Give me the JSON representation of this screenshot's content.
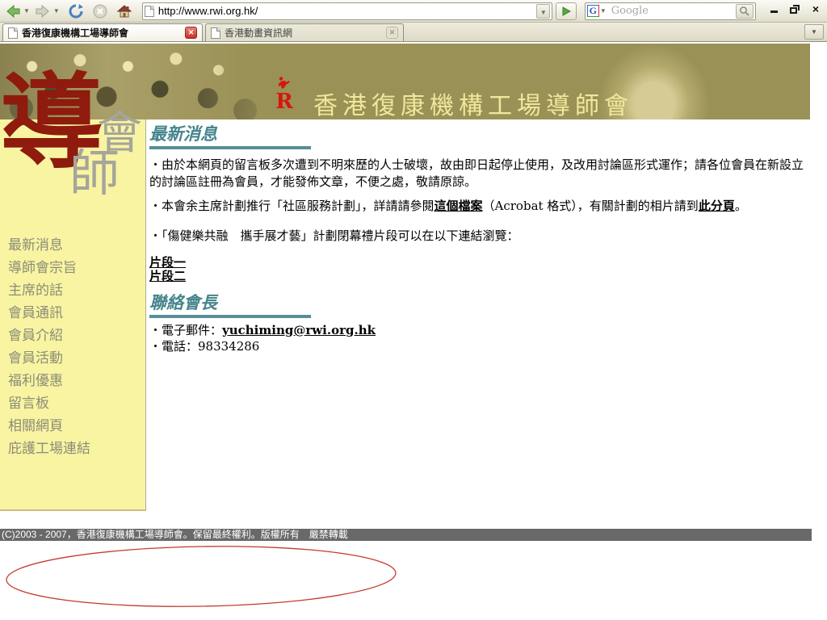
{
  "browser": {
    "url": "http://www.rwi.org.hk/",
    "search": {
      "placeholder": "Google",
      "engine_letter": "G"
    },
    "go_label": "",
    "tabs": [
      {
        "title": "香港復康機構工場導師會"
      },
      {
        "title": "香港動畫資訊網"
      }
    ]
  },
  "banner": {
    "title": "香港復康機構工場導師會",
    "logo_letter": "R"
  },
  "sidebar": {
    "calligraphy": {
      "main": "導",
      "secondary": "會",
      "tertiary": "師"
    },
    "items": [
      "最新消息",
      "導師會宗旨",
      "主席的話",
      "會員通訊",
      "會員介紹",
      "會員活動",
      "福利優惠",
      "留言板",
      "相關網頁",
      "庇護工場連結"
    ]
  },
  "content": {
    "news_heading": "最新消息",
    "p1": "・由於本網頁的留言板多次遭到不明來歷的人士破壞，故由即日起停止使用，及改用討論區形式運作；請各位會員在新設立的討論區註冊為會員，才能發佈文章，不便之處，敬請原諒。",
    "p2_parts": {
      "0": "・本會余主席計劃推行「社區服務計劃」，詳請請參閱",
      "1": "這個檔案",
      "2": "（Acrobat 格式），有關計劃的相片請到",
      "3": "此分頁",
      "4": "。"
    },
    "p3": "・「傷健樂共融　攜手展才藝」計劃閉幕禮片段可以在以下連結瀏覽：",
    "video_links": [
      "片段一",
      "片段二"
    ],
    "contact_heading": "聯絡會長",
    "email_label": "・電子郵件：",
    "email_link": "yuchiming@rwi.org.hk",
    "phone_line": "・電話：98334286"
  },
  "footer": {
    "copyright": "(C)2003 - 2007，香港復康機構工場導師會。保留最終權利。版權所有　嚴禁轉載"
  },
  "colors": {
    "banner_olive": "#9A9156",
    "sidebar_yellow": "#F8F4A2",
    "heading_teal": "#45858C",
    "logo_red": "#D6170D",
    "calligraphy_red": "#8E1B0D",
    "footer_gray": "#696969",
    "annotation_red": "#C33A2E"
  }
}
